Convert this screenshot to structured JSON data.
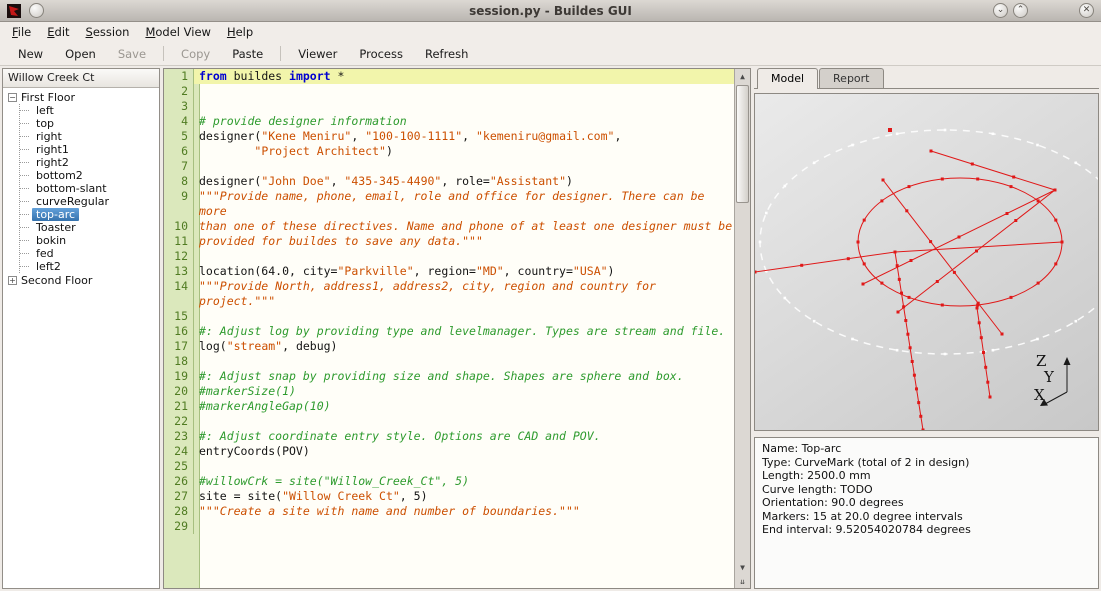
{
  "window": {
    "title": "session.py - Buildes GUI"
  },
  "menubar": {
    "items": [
      "File",
      "Edit",
      "Session",
      "Model View",
      "Help"
    ]
  },
  "toolbar": {
    "groups": [
      [
        "New",
        "Open",
        "Save"
      ],
      [
        "Copy",
        "Paste"
      ],
      [
        "Viewer",
        "Process",
        "Refresh"
      ]
    ],
    "disabled": [
      "Save",
      "Copy"
    ]
  },
  "tree": {
    "header": "Willow Creek Ct",
    "selected": "top-arc",
    "sections": [
      {
        "label": "First Floor",
        "expanded": true,
        "items": [
          "left",
          "top",
          "right",
          "right1",
          "right2",
          "bottom2",
          "bottom-slant",
          "curveRegular",
          "top-arc",
          "Toaster",
          "bokin",
          "fed",
          "left2"
        ]
      },
      {
        "label": "Second Floor",
        "expanded": false,
        "items": []
      }
    ]
  },
  "editor": {
    "lines": [
      {
        "n": 1,
        "hl": true,
        "seg": [
          [
            "k",
            "from"
          ],
          [
            "p",
            " buildes "
          ],
          [
            "k",
            "import"
          ],
          [
            "p",
            " *"
          ]
        ]
      },
      {
        "n": 2,
        "seg": []
      },
      {
        "n": 3,
        "seg": []
      },
      {
        "n": 4,
        "seg": [
          [
            "c",
            "# provide designer information"
          ]
        ]
      },
      {
        "n": 5,
        "seg": [
          [
            "p",
            "designer("
          ],
          [
            "s",
            "\"Kene Meniru\""
          ],
          [
            "p",
            ", "
          ],
          [
            "s",
            "\"100-100-1111\""
          ],
          [
            "p",
            ", "
          ],
          [
            "s",
            "\"kemeniru@gmail.com\""
          ],
          [
            "p",
            ","
          ]
        ]
      },
      {
        "n": 6,
        "seg": [
          [
            "p",
            "        "
          ],
          [
            "s",
            "\"Project Architect\""
          ],
          [
            "p",
            ")"
          ]
        ]
      },
      {
        "n": 7,
        "seg": []
      },
      {
        "n": 8,
        "seg": [
          [
            "p",
            "designer("
          ],
          [
            "s",
            "\"John Doe\""
          ],
          [
            "p",
            ", "
          ],
          [
            "s",
            "\"435-345-4490\""
          ],
          [
            "p",
            ", role="
          ],
          [
            "s",
            "\"Assistant\""
          ],
          [
            "p",
            ")"
          ]
        ]
      },
      {
        "n": 9,
        "seg": [
          [
            "d",
            "\"\"\"Provide name, phone, email, role and office for designer. There can be more"
          ]
        ]
      },
      {
        "n": 10,
        "seg": [
          [
            "d",
            "than one of these directives. Name and phone of at least one designer must be"
          ]
        ]
      },
      {
        "n": 11,
        "seg": [
          [
            "d",
            "provided for buildes to save any data.\"\"\""
          ]
        ]
      },
      {
        "n": 12,
        "seg": []
      },
      {
        "n": 13,
        "seg": [
          [
            "p",
            "location(64.0, city="
          ],
          [
            "s",
            "\"Parkville\""
          ],
          [
            "p",
            ", region="
          ],
          [
            "s",
            "\"MD\""
          ],
          [
            "p",
            ", country="
          ],
          [
            "s",
            "\"USA\""
          ],
          [
            "p",
            ")"
          ]
        ]
      },
      {
        "n": 14,
        "seg": [
          [
            "d",
            "\"\"\"Provide North, address1, address2, city, region and country for project.\"\"\""
          ]
        ]
      },
      {
        "n": 15,
        "seg": []
      },
      {
        "n": 16,
        "seg": [
          [
            "c",
            "#: Adjust log by providing type and levelmanager. Types are stream and file."
          ]
        ]
      },
      {
        "n": 17,
        "seg": [
          [
            "p",
            "log("
          ],
          [
            "s",
            "\"stream\""
          ],
          [
            "p",
            ", debug)"
          ]
        ]
      },
      {
        "n": 18,
        "seg": []
      },
      {
        "n": 19,
        "seg": [
          [
            "c",
            "#: Adjust snap by providing size and shape. Shapes are sphere and box."
          ]
        ]
      },
      {
        "n": 20,
        "seg": [
          [
            "c",
            "#markerSize(1)"
          ]
        ]
      },
      {
        "n": 21,
        "seg": [
          [
            "c",
            "#markerAngleGap(10)"
          ]
        ]
      },
      {
        "n": 22,
        "seg": []
      },
      {
        "n": 23,
        "seg": [
          [
            "c",
            "#: Adjust coordinate entry style. Options are CAD and POV."
          ]
        ]
      },
      {
        "n": 24,
        "seg": [
          [
            "p",
            "entryCoords(POV)"
          ]
        ]
      },
      {
        "n": 25,
        "seg": []
      },
      {
        "n": 26,
        "seg": [
          [
            "c",
            "#willowCrk = site(\"Willow_Creek_Ct\", 5)"
          ]
        ]
      },
      {
        "n": 27,
        "seg": [
          [
            "p",
            "site = site("
          ],
          [
            "s",
            "\"Willow Creek Ct\""
          ],
          [
            "p",
            ", 5)"
          ]
        ]
      },
      {
        "n": 28,
        "seg": [
          [
            "d",
            "\"\"\"Create a site with name and number of boundaries.\"\"\""
          ]
        ]
      },
      {
        "n": 29,
        "seg": []
      }
    ]
  },
  "right": {
    "tabs": [
      "Model",
      "Report"
    ],
    "active_tab": "Model",
    "axis_labels": [
      "Z",
      "Y",
      "X"
    ],
    "info": [
      "Name: Top-arc",
      "Type: CurveMark (total of 2 in design)",
      "Length: 2500.0 mm",
      "Curve length: TODO",
      "Orientation: 90.0 degrees",
      "Markers: 15 at 20.0 degree intervals",
      "End interval: 9.52054020784 degrees"
    ]
  }
}
